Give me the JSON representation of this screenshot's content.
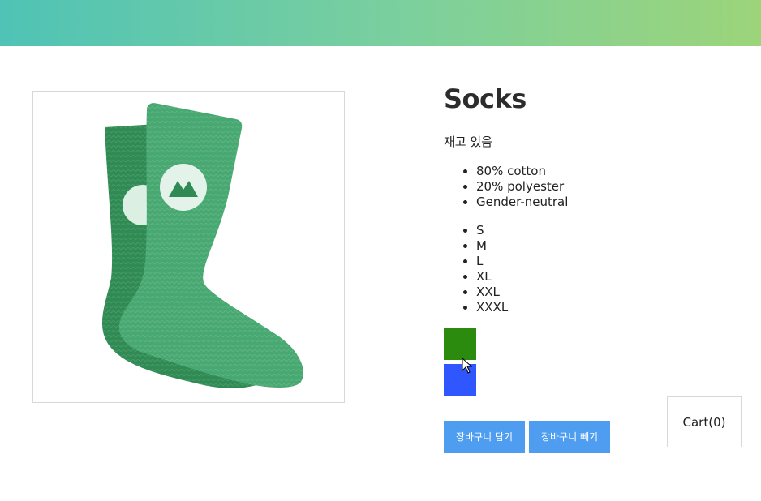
{
  "product": {
    "image_alt": "green socks",
    "title": "Socks",
    "stock_status": "재고 있음",
    "details": [
      "80% cotton",
      "20% polyester",
      "Gender-neutral"
    ],
    "sizes": [
      "S",
      "M",
      "L",
      "XL",
      "XXL",
      "XXXL"
    ],
    "variants": [
      {
        "color": "#2a8b0e"
      },
      {
        "color": "#3057ff"
      }
    ],
    "add_to_cart_label": "장바구니 담기",
    "remove_from_cart_label": "장바구니 빼기"
  },
  "cart": {
    "label": "Cart(0)"
  },
  "theme": {
    "nav_gradient_start": "#4fc3b6",
    "nav_gradient_end": "#9cd47a",
    "button_color": "#4e9df0"
  },
  "icons": {
    "cursor": "mouse-pointer-icon"
  }
}
